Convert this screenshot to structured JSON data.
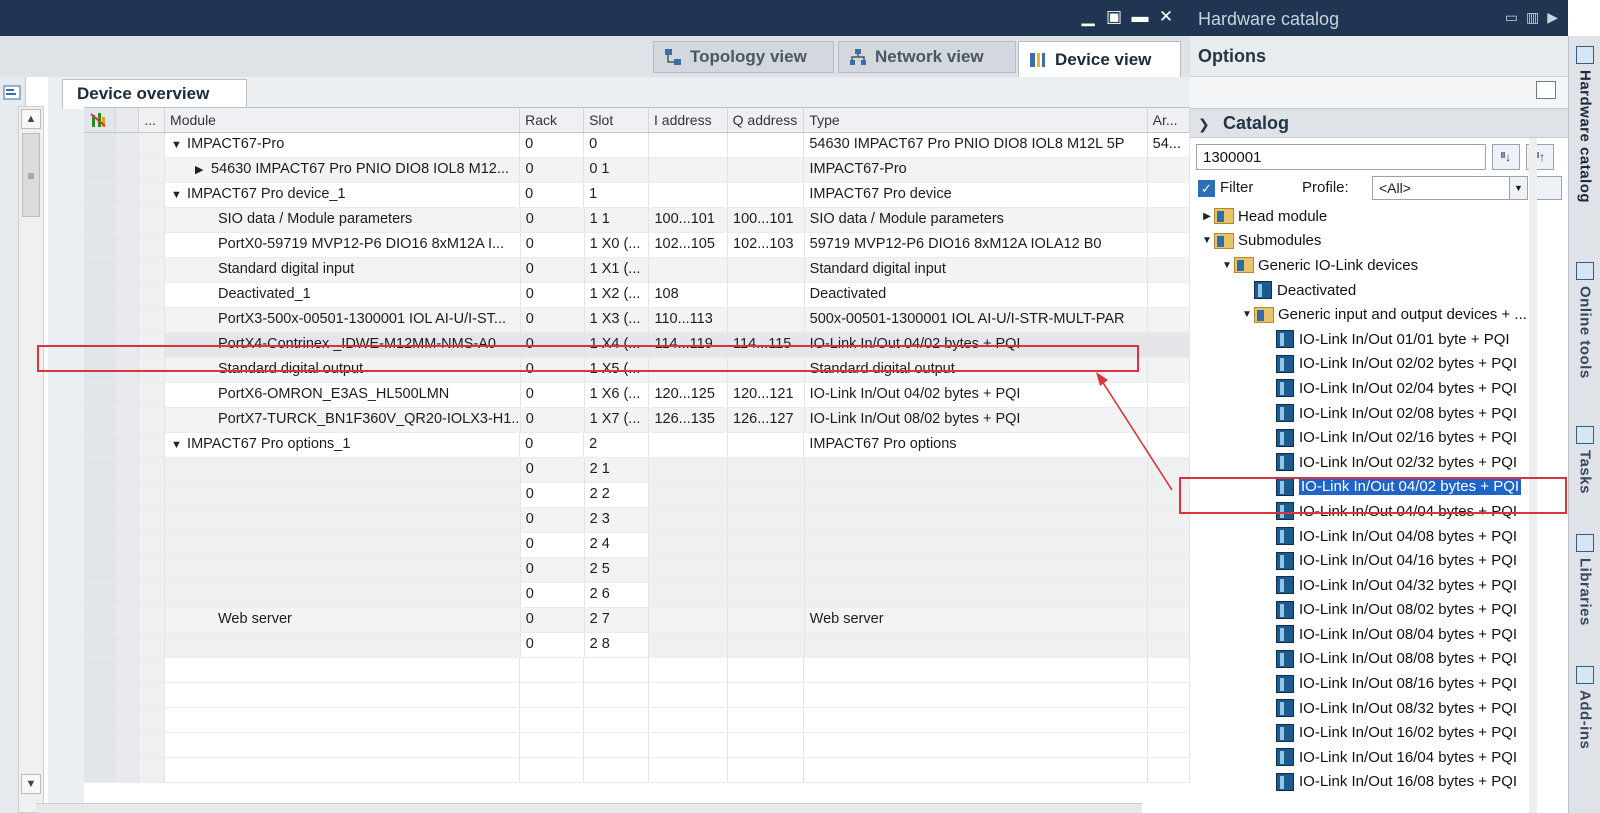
{
  "window_controls": [
    "▁",
    "▣",
    "▬",
    "✕"
  ],
  "views": {
    "topology": "Topology view",
    "network": "Network view",
    "device": "Device view"
  },
  "device_overview": {
    "tab_label": "Device overview",
    "columns": [
      "",
      "",
      "...",
      "Module",
      "Rack",
      "Slot",
      "I address",
      "Q address",
      "Type",
      "Ar..."
    ],
    "rows": [
      {
        "module": "IMPACT67-Pro",
        "indent": 1,
        "toggle": "▼",
        "rack": "0",
        "slot": "0",
        "iaddr": "",
        "qaddr": "",
        "type": "54630 IMPACT67 Pro PNIO DIO8 IOL8 M12L 5P",
        "ar": "54..."
      },
      {
        "module": "54630 IMPACT67 Pro PNIO DIO8 IOL8 M12...",
        "indent": 2,
        "toggle": "▶",
        "rack": "0",
        "slot": "0 1",
        "iaddr": "",
        "qaddr": "",
        "type": "IMPACT67-Pro",
        "ar": ""
      },
      {
        "module": "IMPACT67 Pro device_1",
        "indent": 1,
        "toggle": "▼",
        "rack": "0",
        "slot": "1",
        "iaddr": "",
        "qaddr": "",
        "type": "IMPACT67 Pro device",
        "ar": ""
      },
      {
        "module": "SIO data / Module parameters",
        "indent": 2,
        "toggle": "",
        "rack": "0",
        "slot": "1 1",
        "iaddr": "100...101",
        "qaddr": "100...101",
        "type": "SIO data / Module parameters",
        "ar": ""
      },
      {
        "module": "PortX0-59719 MVP12-P6 DIO16 8xM12A I...",
        "indent": 2,
        "toggle": "",
        "rack": "0",
        "slot": "1 X0 (...",
        "iaddr": "102...105",
        "qaddr": "102...103",
        "type": "59719 MVP12-P6 DIO16 8xM12A IOLA12 B0",
        "ar": ""
      },
      {
        "module": "Standard digital input",
        "indent": 2,
        "toggle": "",
        "rack": "0",
        "slot": "1 X1 (...",
        "iaddr": "",
        "qaddr": "",
        "type": "Standard digital input",
        "ar": ""
      },
      {
        "module": "Deactivated_1",
        "indent": 2,
        "toggle": "",
        "rack": "0",
        "slot": "1 X2 (...",
        "iaddr": "108",
        "qaddr": "",
        "type": "Deactivated",
        "ar": ""
      },
      {
        "module": "PortX3-500x-00501-1300001 IOL AI-U/I-ST...",
        "indent": 2,
        "toggle": "",
        "rack": "0",
        "slot": "1 X3 (...",
        "iaddr": "110...113",
        "qaddr": "",
        "type": "500x-00501-1300001 IOL AI-U/I-STR-MULT-PAR",
        "ar": ""
      },
      {
        "module": "PortX4-Contrinex _IDWE-M12MM-NMS-A0",
        "indent": 2,
        "toggle": "",
        "rack": "0",
        "slot": "1 X4 (...",
        "iaddr": "114...119",
        "qaddr": "114...115",
        "type": "IO-Link In/Out 04/02 bytes + PQI",
        "ar": "",
        "selected": true
      },
      {
        "module": "Standard digital output",
        "indent": 2,
        "toggle": "",
        "rack": "0",
        "slot": "1 X5 (...",
        "iaddr": "",
        "qaddr": "",
        "type": "Standard digital output",
        "ar": ""
      },
      {
        "module": "PortX6-OMRON_E3AS_HL500LMN",
        "indent": 2,
        "toggle": "",
        "rack": "0",
        "slot": "1 X6 (...",
        "iaddr": "120...125",
        "qaddr": "120...121",
        "type": "IO-Link In/Out 04/02 bytes + PQI",
        "ar": ""
      },
      {
        "module": "PortX7-TURCK_BN1F360V_QR20-IOLX3-H1...",
        "indent": 2,
        "toggle": "",
        "rack": "0",
        "slot": "1 X7 (...",
        "iaddr": "126...135",
        "qaddr": "126...127",
        "type": "IO-Link In/Out 08/02 bytes + PQI",
        "ar": ""
      },
      {
        "module": "IMPACT67 Pro options_1",
        "indent": 1,
        "toggle": "▼",
        "rack": "0",
        "slot": "2",
        "iaddr": "",
        "qaddr": "",
        "type": "IMPACT67 Pro options",
        "ar": ""
      },
      {
        "module": "",
        "indent": 2,
        "toggle": "",
        "rack": "0",
        "slot": "2 1",
        "iaddr": "",
        "qaddr": "",
        "type": "",
        "ar": "",
        "empty": true
      },
      {
        "module": "",
        "indent": 2,
        "toggle": "",
        "rack": "0",
        "slot": "2 2",
        "iaddr": "",
        "qaddr": "",
        "type": "",
        "ar": "",
        "empty": true
      },
      {
        "module": "",
        "indent": 2,
        "toggle": "",
        "rack": "0",
        "slot": "2 3",
        "iaddr": "",
        "qaddr": "",
        "type": "",
        "ar": "",
        "empty": true
      },
      {
        "module": "",
        "indent": 2,
        "toggle": "",
        "rack": "0",
        "slot": "2 4",
        "iaddr": "",
        "qaddr": "",
        "type": "",
        "ar": "",
        "empty": true
      },
      {
        "module": "",
        "indent": 2,
        "toggle": "",
        "rack": "0",
        "slot": "2 5",
        "iaddr": "",
        "qaddr": "",
        "type": "",
        "ar": "",
        "empty": true
      },
      {
        "module": "",
        "indent": 2,
        "toggle": "",
        "rack": "0",
        "slot": "2 6",
        "iaddr": "",
        "qaddr": "",
        "type": "",
        "ar": "",
        "empty": true
      },
      {
        "module": "Web server",
        "indent": 2,
        "toggle": "",
        "rack": "0",
        "slot": "2 7",
        "iaddr": "",
        "qaddr": "",
        "type": "Web server",
        "ar": ""
      },
      {
        "module": "",
        "indent": 2,
        "toggle": "",
        "rack": "0",
        "slot": "2 8",
        "iaddr": "",
        "qaddr": "",
        "type": "",
        "ar": "",
        "empty": true
      }
    ]
  },
  "catalog": {
    "title": "Hardware catalog",
    "options_label": "Options",
    "section_label": "Catalog",
    "search_value": "1300001",
    "filter_label": "Filter",
    "filter_checked": true,
    "profile_label": "Profile:",
    "profile_value": "<All>",
    "tree": [
      {
        "label": "Head module",
        "level": 0,
        "toggle": "▶",
        "icon": "folder"
      },
      {
        "label": "Submodules",
        "level": 0,
        "toggle": "▼",
        "icon": "folder"
      },
      {
        "label": "Generic IO-Link devices",
        "level": 1,
        "toggle": "▼",
        "icon": "folder"
      },
      {
        "label": "Deactivated",
        "level": 2,
        "toggle": "",
        "icon": "device"
      },
      {
        "label": "Generic input and output devices + ...",
        "level": 2,
        "toggle": "▼",
        "icon": "folder"
      },
      {
        "label": "IO-Link In/Out 01/01 byte + PQI",
        "level": 3,
        "toggle": "",
        "icon": "device"
      },
      {
        "label": "IO-Link In/Out 02/02 bytes + PQI",
        "level": 3,
        "toggle": "",
        "icon": "device"
      },
      {
        "label": "IO-Link In/Out 02/04 bytes + PQI",
        "level": 3,
        "toggle": "",
        "icon": "device"
      },
      {
        "label": "IO-Link In/Out 02/08 bytes + PQI",
        "level": 3,
        "toggle": "",
        "icon": "device"
      },
      {
        "label": "IO-Link In/Out 02/16 bytes + PQI",
        "level": 3,
        "toggle": "",
        "icon": "device"
      },
      {
        "label": "IO-Link In/Out 02/32 bytes + PQI",
        "level": 3,
        "toggle": "",
        "icon": "device"
      },
      {
        "label": "IO-Link In/Out 04/02 bytes + PQI",
        "level": 3,
        "toggle": "",
        "icon": "device",
        "selected": true
      },
      {
        "label": "IO-Link In/Out 04/04 bytes + PQI",
        "level": 3,
        "toggle": "",
        "icon": "device"
      },
      {
        "label": "IO-Link In/Out 04/08 bytes + PQI",
        "level": 3,
        "toggle": "",
        "icon": "device"
      },
      {
        "label": "IO-Link In/Out 04/16 bytes + PQI",
        "level": 3,
        "toggle": "",
        "icon": "device"
      },
      {
        "label": "IO-Link In/Out 04/32 bytes + PQI",
        "level": 3,
        "toggle": "",
        "icon": "device"
      },
      {
        "label": "IO-Link In/Out 08/02 bytes + PQI",
        "level": 3,
        "toggle": "",
        "icon": "device"
      },
      {
        "label": "IO-Link In/Out 08/04 bytes + PQI",
        "level": 3,
        "toggle": "",
        "icon": "device"
      },
      {
        "label": "IO-Link In/Out 08/08 bytes + PQI",
        "level": 3,
        "toggle": "",
        "icon": "device"
      },
      {
        "label": "IO-Link In/Out 08/16 bytes + PQI",
        "level": 3,
        "toggle": "",
        "icon": "device"
      },
      {
        "label": "IO-Link In/Out 08/32 bytes + PQI",
        "level": 3,
        "toggle": "",
        "icon": "device"
      },
      {
        "label": "IO-Link In/Out 16/02 bytes + PQI",
        "level": 3,
        "toggle": "",
        "icon": "device"
      },
      {
        "label": "IO-Link In/Out 16/04 bytes + PQI",
        "level": 3,
        "toggle": "",
        "icon": "device"
      },
      {
        "label": "IO-Link In/Out 16/08 bytes + PQI",
        "level": 3,
        "toggle": "",
        "icon": "device"
      }
    ]
  },
  "side_tabs": [
    "Hardware catalog",
    "Online tools",
    "Tasks",
    "Libraries",
    "Add-ins"
  ],
  "colors": {
    "titlebar": "#1f3551",
    "selection": "#1f64c8",
    "annotation": "#d9343b"
  }
}
